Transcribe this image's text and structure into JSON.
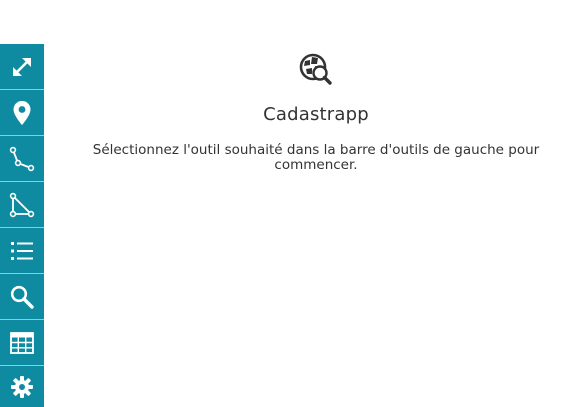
{
  "toolbar": {
    "bg_color": "#0e8ba0",
    "tools": [
      {
        "icon": "expand-icon"
      },
      {
        "icon": "map-marker-icon"
      },
      {
        "icon": "line-select-icon"
      },
      {
        "icon": "polygon-select-icon"
      },
      {
        "icon": "list-icon"
      },
      {
        "icon": "search-icon"
      },
      {
        "icon": "table-icon"
      },
      {
        "icon": "gear-icon"
      }
    ]
  },
  "panel": {
    "app_icon": "cadastre-search-icon",
    "title": "Cadastrapp",
    "instruction": "Sélectionnez l'outil souhaité dans la barre d'outils de gauche pour commencer."
  }
}
